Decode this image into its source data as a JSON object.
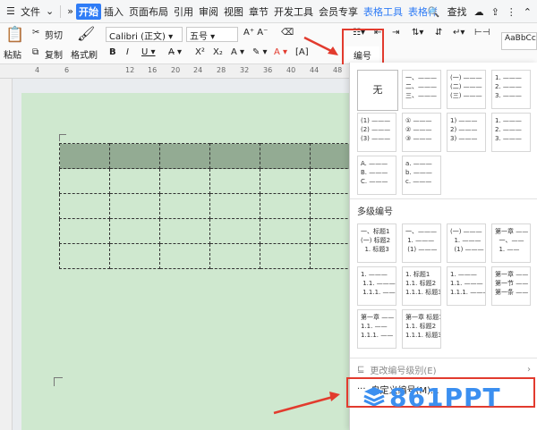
{
  "menubar": {
    "file": "文件",
    "tabs": [
      "开始",
      "插入",
      "页面布局",
      "引用",
      "审阅",
      "视图",
      "章节",
      "开发工具",
      "会员专享",
      "表格工具",
      "表格样"
    ],
    "search": "查找"
  },
  "toolbar": {
    "paste": "粘贴",
    "cut": "剪切",
    "copy": "复制",
    "format_painter": "格式刷",
    "font_name": "Calibri (正文)",
    "font_size": "五号",
    "numbering_label": "编号",
    "style_preview": "AaBbCc"
  },
  "ruler": [
    "4",
    "6",
    "12",
    "16",
    "20",
    "24",
    "28",
    "32",
    "36",
    "40",
    "44",
    "48"
  ],
  "dropdown": {
    "none_label": "无",
    "single_options": [
      "一、———\n二、———\n三、———",
      "(一) ———\n(二) ———\n(三) ———",
      "1. ———\n2. ———\n3. ———",
      "(1) ———\n(2) ———\n(3) ———",
      "① ———\n② ———\n③ ———",
      "1) ———\n2) ———\n3) ———",
      "1. ———\n2. ———\n3. ———",
      "A. ———\nB. ———\nC. ———",
      "a. ———\nb. ———\nc. ———"
    ],
    "multi_title": "多级编号",
    "multi_options": [
      "一、标题1\n(一) 标题2\n  1. 标题3",
      "一、———\n 1. ———\n (1) ———",
      "(一) ———\n  1. ———\n  (1) ———",
      "第一章 ——\n  一、——\n  1. ——",
      "1. ———\n 1.1. ———\n 1.1.1. ———",
      "1. 标题1\n1.1. 标题2\n1.1.1. 标题3",
      "1. ———\n1.1. ———\n1.1.1. ———",
      "第一章 ——\n第一节 ——\n第一条 ——",
      "第一章 ——\n1.1. ——\n1.1.1. ——",
      "第一章 标题1\n1.1. 标题2\n1.1.1. 标题3"
    ],
    "change_level": "更改编号级别(E)",
    "custom_numbering": "自定义编号(M)..."
  },
  "watermark": "861PPT",
  "colors": {
    "accent": "#2f7cf6",
    "highlight": "#e23b2e",
    "page": "#cfe8cf"
  }
}
